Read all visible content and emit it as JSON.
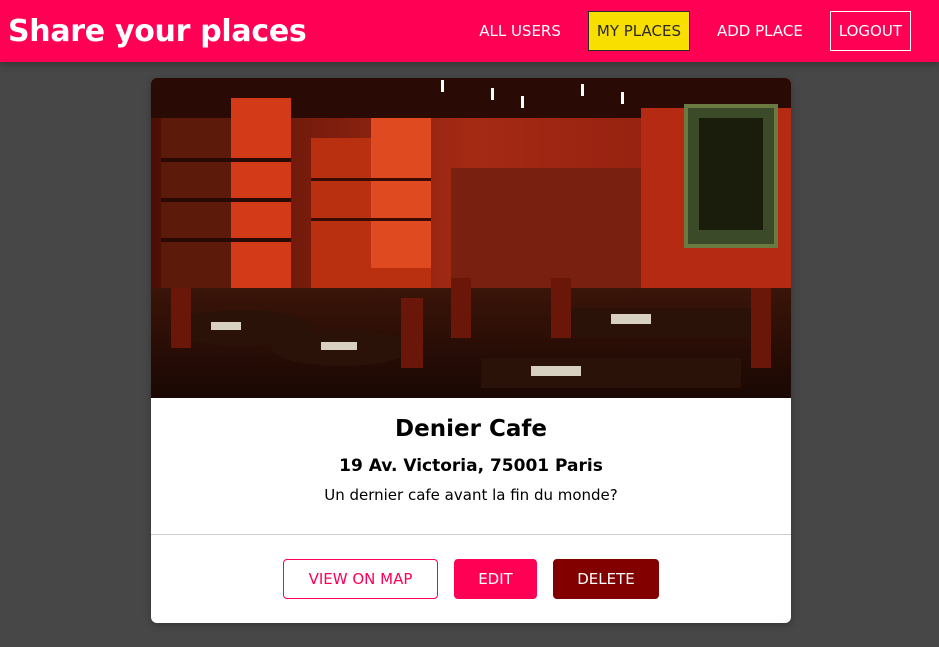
{
  "header": {
    "brand": "Share your places",
    "nav": [
      {
        "label": "ALL USERS"
      },
      {
        "label": "MY PLACES"
      },
      {
        "label": "ADD PLACE"
      },
      {
        "label": "LOGOUT"
      }
    ]
  },
  "place": {
    "title": "Denier Cafe",
    "address": "19 Av. Victoria, 75001 Paris",
    "description": "Un dernier cafe avant la fin du monde?",
    "image_icon": "cafe-photo"
  },
  "actions": {
    "view_on_map": "VIEW ON MAP",
    "edit": "EDIT",
    "delete": "DELETE"
  },
  "colors": {
    "accent": "#ff0055",
    "active_nav": "#f8df00",
    "delete": "#830000",
    "background": "#474747"
  }
}
